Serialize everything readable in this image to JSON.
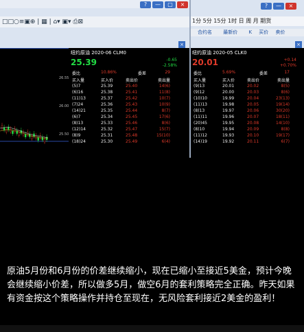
{
  "window": {
    "buttons": [
      "?",
      "—",
      "▢",
      "×"
    ],
    "toolbar_left_icons": "□□○≡▣⊕ | ▦ | ⌂▾ ▣▾ ⎙⊠"
  },
  "right_toolbar": {
    "items": [
      "1分",
      "5分",
      "15分",
      "1时",
      "日",
      "周",
      "月",
      "期货"
    ],
    "columns": [
      "合约名",
      "最新价",
      "K",
      "买价",
      "卖价"
    ]
  },
  "chart": {
    "ticks": [
      "26.55",
      "26.00",
      "25.50"
    ]
  },
  "panels": [
    {
      "title": "纽约原油 2020-06  CLM0",
      "price": "25.39",
      "change": "-0.65",
      "pct": "-2.58%",
      "meta": {
        "label1": "委比",
        "value1": "10.86%",
        "label2": "委差",
        "value2": "29"
      },
      "headers": [
        "买入量",
        "买入价",
        "卖出价",
        "卖出量"
      ],
      "rows": [
        [
          "(5)7",
          "25.39",
          "25.40",
          "14(6)"
        ],
        [
          "(6)16",
          "25.38",
          "25.41",
          "11(8)"
        ],
        [
          "(11)13",
          "25.37",
          "25.42",
          "10(7)"
        ],
        [
          "(7)24",
          "25.36",
          "25.43",
          "10(9)"
        ],
        [
          "(14)21",
          "25.35",
          "25.44",
          "8(7)"
        ],
        [
          "(6)7",
          "25.34",
          "25.45",
          "17(6)"
        ],
        [
          "(8)13",
          "25.33",
          "25.46",
          "8(6)"
        ],
        [
          "(12)14",
          "25.32",
          "25.47",
          "15(7)"
        ],
        [
          "(8)9",
          "25.31",
          "25.48",
          "15(10)"
        ],
        [
          "(18)24",
          "25.30",
          "25.49",
          "6(4)"
        ]
      ]
    },
    {
      "title": "纽约原油 2020-05  CLK0",
      "price": "20.01",
      "change": "+0.14",
      "pct": "+0.70%",
      "meta": {
        "label1": "委比",
        "value1": "5.69%",
        "label2": "委差",
        "value2": "17"
      },
      "headers": [
        "买入量",
        "买入价",
        "卖出价",
        "卖出量"
      ],
      "rows": [
        [
          "(9)13",
          "20.01",
          "20.02",
          "8(5)"
        ],
        [
          "(9)12",
          "20.00",
          "20.03",
          "8(6)"
        ],
        [
          "(10)10",
          "19.99",
          "20.04",
          "23(13)"
        ],
        [
          "(11)13",
          "19.98",
          "20.05",
          "19(14)"
        ],
        [
          "(8)13",
          "19.97",
          "20.06",
          "30(20)"
        ],
        [
          "(11)11",
          "19.96",
          "20.07",
          "18(11)"
        ],
        [
          "(20)45",
          "19.95",
          "20.08",
          "14(10)"
        ],
        [
          "(8)10",
          "19.94",
          "20.09",
          "8(8)"
        ],
        [
          "(11)12",
          "19.93",
          "20.10",
          "19(17)"
        ],
        [
          "(14)19",
          "19.92",
          "20.11",
          "6(7)"
        ]
      ]
    }
  ],
  "caption": "原油5月份和6月份的价差继续缩小，现在已缩小至接近5美金，预计今晚会继续缩小价差，所以做多5月，做空6月的套利策略完全正确。昨天如果有资金按这个策略操作并持仓至现在，无风险套利接近2美金的盈利！",
  "colors": {
    "up": "#e03a2a",
    "down": "#22dd44",
    "bg": "#000000"
  }
}
